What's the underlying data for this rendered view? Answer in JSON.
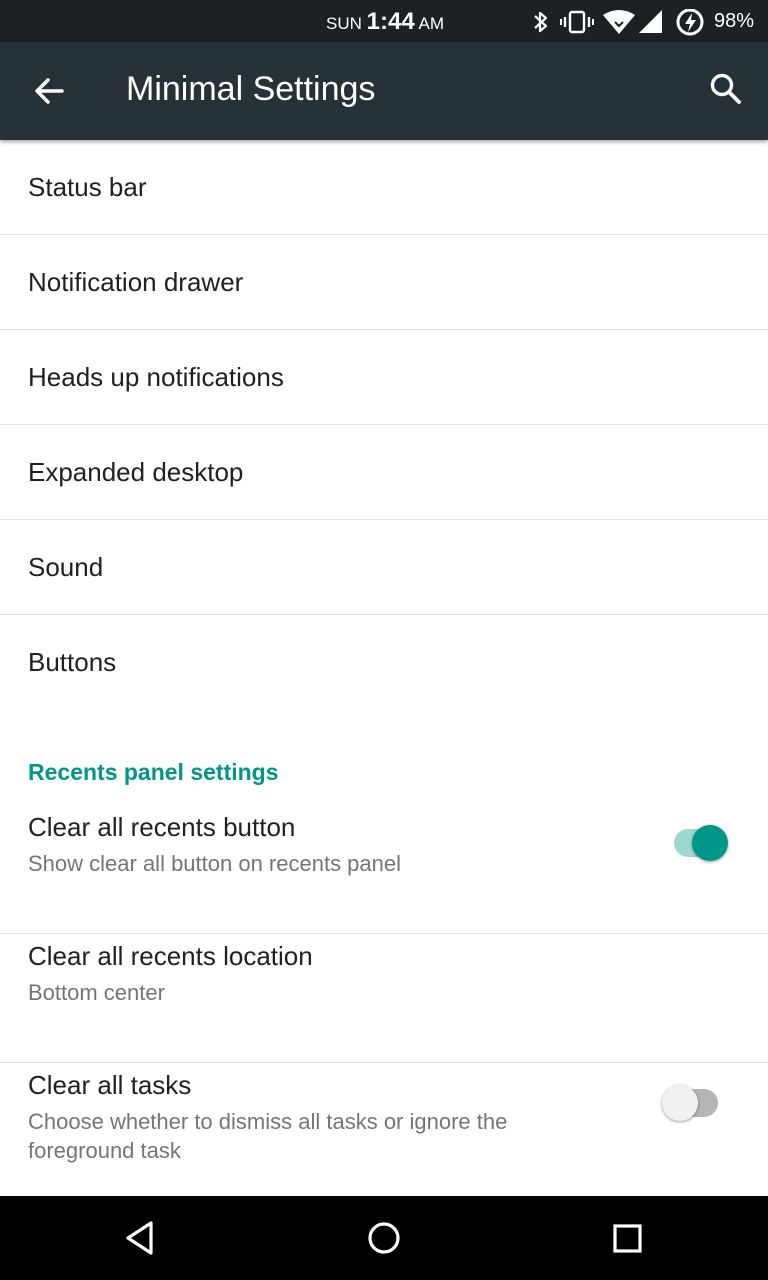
{
  "status_bar": {
    "day": "SUN",
    "time": "1:44",
    "ampm": "AM",
    "battery": "98%",
    "icons": [
      "bluetooth-icon",
      "vibrate-icon",
      "wifi-icon",
      "cell-signal-icon",
      "battery-charging-icon"
    ]
  },
  "toolbar": {
    "title": "Minimal Settings",
    "back_icon": "arrow-back-icon",
    "search_icon": "search-icon"
  },
  "items": [
    {
      "label": "Status bar"
    },
    {
      "label": "Notification drawer"
    },
    {
      "label": "Heads up notifications"
    },
    {
      "label": "Expanded desktop"
    },
    {
      "label": "Sound"
    },
    {
      "label": "Buttons"
    }
  ],
  "recents": {
    "header": "Recents panel settings",
    "clear_all_button": {
      "title": "Clear all recents button",
      "summary": "Show clear all button on recents panel",
      "enabled": true
    },
    "clear_all_location": {
      "title": "Clear all recents location",
      "summary": "Bottom center"
    },
    "clear_all_tasks": {
      "title": "Clear all tasks",
      "summary": "Choose whether to dismiss all tasks or ignore the foreground task",
      "enabled": false
    }
  },
  "nav_bar": {
    "icons": [
      "back-triangle-icon",
      "home-circle-icon",
      "recents-square-icon"
    ]
  },
  "colors": {
    "accent": "#009688",
    "toolbar": "#263238",
    "status_bar": "#1c2125"
  }
}
